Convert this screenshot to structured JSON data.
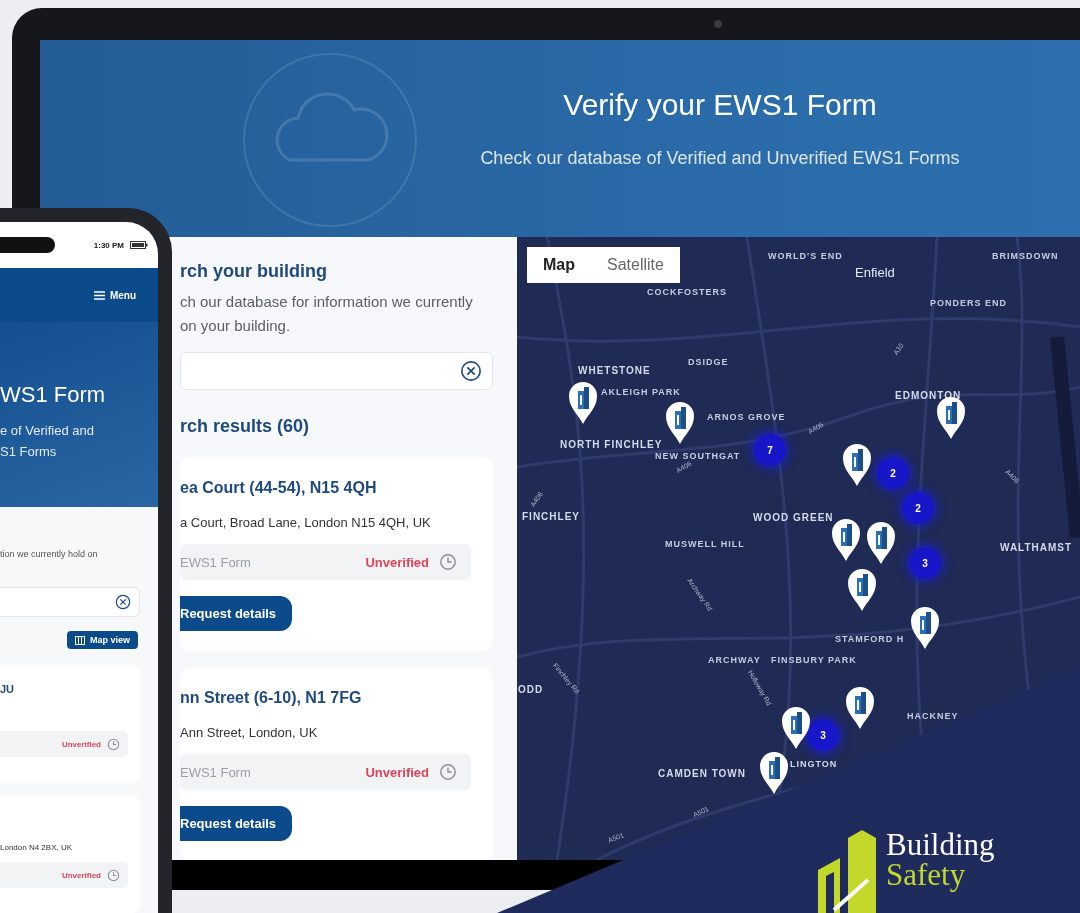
{
  "laptop": {
    "header": {
      "title": "Verify your EWS1 Form",
      "subtitle": "Check our database of Verified and Unverified EWS1 Forms"
    },
    "search_panel": {
      "heading": "rch your building",
      "description_lines": [
        "ch our database for information we currently",
        "on your building."
      ],
      "results_heading": "rch results (60)",
      "results": [
        {
          "title": "ea Court (44-54), N15 4QH",
          "address": "a Court, Broad Lane, London N15 4QH, UK",
          "form_label": "EWS1 Form",
          "status": "Unverified",
          "verified": false,
          "button": "Request details"
        },
        {
          "title": "nn Street (6-10), N1 7FG",
          "address": "Ann Street, London, UK",
          "form_label": "EWS1 Form",
          "status": "Unverified",
          "verified": false,
          "button": "Request details"
        }
      ]
    },
    "map": {
      "view_options": [
        {
          "label": "Map",
          "selected": true
        },
        {
          "label": "Satellite",
          "selected": false
        }
      ],
      "place_labels": [
        {
          "text": "WORLD'S END",
          "kind": "area"
        },
        {
          "text": "Enfield",
          "kind": "town"
        },
        {
          "text": "BRIMSDOWN",
          "kind": "area"
        },
        {
          "text": "COCKFOSTERS",
          "kind": "area"
        },
        {
          "text": "PONDERS END",
          "kind": "area"
        },
        {
          "text": "DSIDGE",
          "kind": "area"
        },
        {
          "text": "WHETSTONE",
          "kind": "district"
        },
        {
          "text": "AKLEIGH PARK",
          "kind": "area"
        },
        {
          "text": "EDMONTON",
          "kind": "district"
        },
        {
          "text": "ARNOS GROVE",
          "kind": "area"
        },
        {
          "text": "NORTH FINCHLEY",
          "kind": "district"
        },
        {
          "text": "NEW SOUTHGAT",
          "kind": "area"
        },
        {
          "text": "FINCHLEY",
          "kind": "district"
        },
        {
          "text": "WOOD GREEN",
          "kind": "district"
        },
        {
          "text": "MUSWELL HILL",
          "kind": "area"
        },
        {
          "text": "WALTHAMST",
          "kind": "district"
        },
        {
          "text": "STAMFORD H",
          "kind": "area"
        },
        {
          "text": "ARCHWAY",
          "kind": "area"
        },
        {
          "text": "FINSBURY PARK",
          "kind": "area"
        },
        {
          "text": "ODD",
          "kind": "district"
        },
        {
          "text": "HACKNEY",
          "kind": "area"
        },
        {
          "text": "CAMDEN TOWN",
          "kind": "district"
        },
        {
          "text": "LINGTON",
          "kind": "district"
        },
        {
          "text": "A10",
          "kind": "road"
        },
        {
          "text": "A406",
          "kind": "road"
        },
        {
          "text": "A406",
          "kind": "road"
        },
        {
          "text": "A406",
          "kind": "road"
        },
        {
          "text": "A406",
          "kind": "road"
        },
        {
          "text": "Archway Rd",
          "kind": "road"
        },
        {
          "text": "Holloway Rd",
          "kind": "road"
        },
        {
          "text": "Finchley Rd",
          "kind": "road"
        },
        {
          "text": "A501",
          "kind": "road"
        },
        {
          "text": "A501",
          "kind": "road"
        }
      ],
      "clusters": [
        {
          "count": "7"
        },
        {
          "count": "2"
        },
        {
          "count": "2"
        },
        {
          "count": "3"
        },
        {
          "count": "3"
        }
      ]
    }
  },
  "phone": {
    "status_time": "1:30 PM",
    "menu_label": "Menu",
    "hero_title": "WS1 Form",
    "hero_lines": [
      "e of Verified and",
      "S1 Forms"
    ],
    "description": "tion we currently hold on",
    "map_view_button": "Map view",
    "results": [
      {
        "title": "JU",
        "status": "Unverified",
        "verified": false
      },
      {
        "address": "London N4 2BX, UK",
        "status": "Unverified",
        "verified": false
      }
    ]
  },
  "brand": {
    "line_1": "Building",
    "line_2": "Safety"
  }
}
